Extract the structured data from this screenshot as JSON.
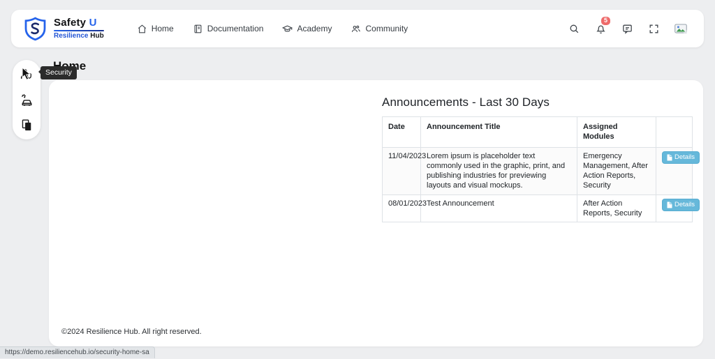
{
  "brand": {
    "name_primary": "Safety",
    "name_accent": "U",
    "sub_blue": "Resilience",
    "sub_dark": "Hub"
  },
  "nav": {
    "items": [
      {
        "label": "Home"
      },
      {
        "label": "Documentation"
      },
      {
        "label": "Academy"
      },
      {
        "label": "Community"
      }
    ]
  },
  "header_actions": {
    "notification_count": "5"
  },
  "sidebar": {
    "tooltip": "Security"
  },
  "page": {
    "title": "Home"
  },
  "announcements": {
    "title": "Announcements - Last 30 Days",
    "table": {
      "headers": [
        "Date",
        "Announcement Title",
        "Assigned Modules",
        ""
      ],
      "rows": [
        {
          "date": "11/04/2023",
          "title": "Lorem ipsum is placeholder text commonly used in the graphic, print, and publishing industries for previewing layouts and visual mockups.",
          "modules": "Emergency Management, After Action Reports, Security",
          "action": "Details"
        },
        {
          "date": "08/01/2023",
          "title": "Test Announcement",
          "modules": "After Action Reports, Security",
          "action": "Details"
        }
      ]
    }
  },
  "footer": {
    "copyright": "©2024 Resilience Hub. All right reserved."
  },
  "status_bar": {
    "url": "https://demo.resiliencehub.io/security-home-sa"
  },
  "colors": {
    "accent_blue": "#2563eb",
    "details_button": "#66b8da",
    "badge_red": "#ee6b6b",
    "tooltip_bg": "#2b2b2b",
    "page_bg": "#edeef0"
  }
}
